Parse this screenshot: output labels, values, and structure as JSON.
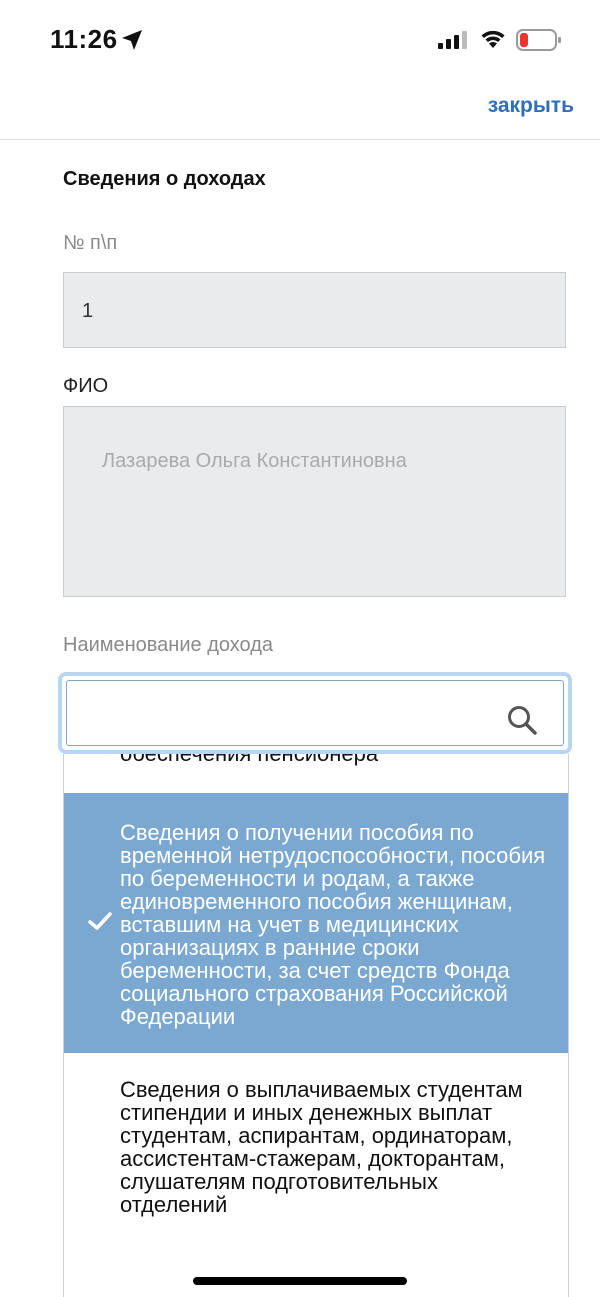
{
  "status_bar": {
    "time": "11:26"
  },
  "header": {
    "close_label": "закрыть"
  },
  "form": {
    "section_title": "Сведения о доходах",
    "number_label": "№ п\\п",
    "number_value": "1",
    "fio_label": "ФИО",
    "fio_value": "Лазарева Ольга Константиновна",
    "income_label": "Наименование дохода",
    "search_value": ""
  },
  "dropdown": {
    "options": [
      {
        "label": "обеспечения пенсионера"
      },
      {
        "label": "Сведения о получении пособия по временной нетрудоспособности, пособия по беременности и родам, а также единовременного пособия женщинам, вставшим на учет в медицинских организациях в ранние сроки беременности, за счет средств Фонда социального страхования Российской Федерации",
        "selected": true
      },
      {
        "label": "Сведения о выплачиваемых студентам стипендии и иных денежных выплат студентам, аспирантам, ординаторам, ассистентам-стажерам, докторантам, слушателям подготовительных отделений"
      }
    ]
  },
  "colors": {
    "accent": "#2e6fb7",
    "selected_option_bg": "#7ba8d0",
    "readonly_bg": "#eaebed",
    "focus_ring": "#b8d6f0"
  }
}
